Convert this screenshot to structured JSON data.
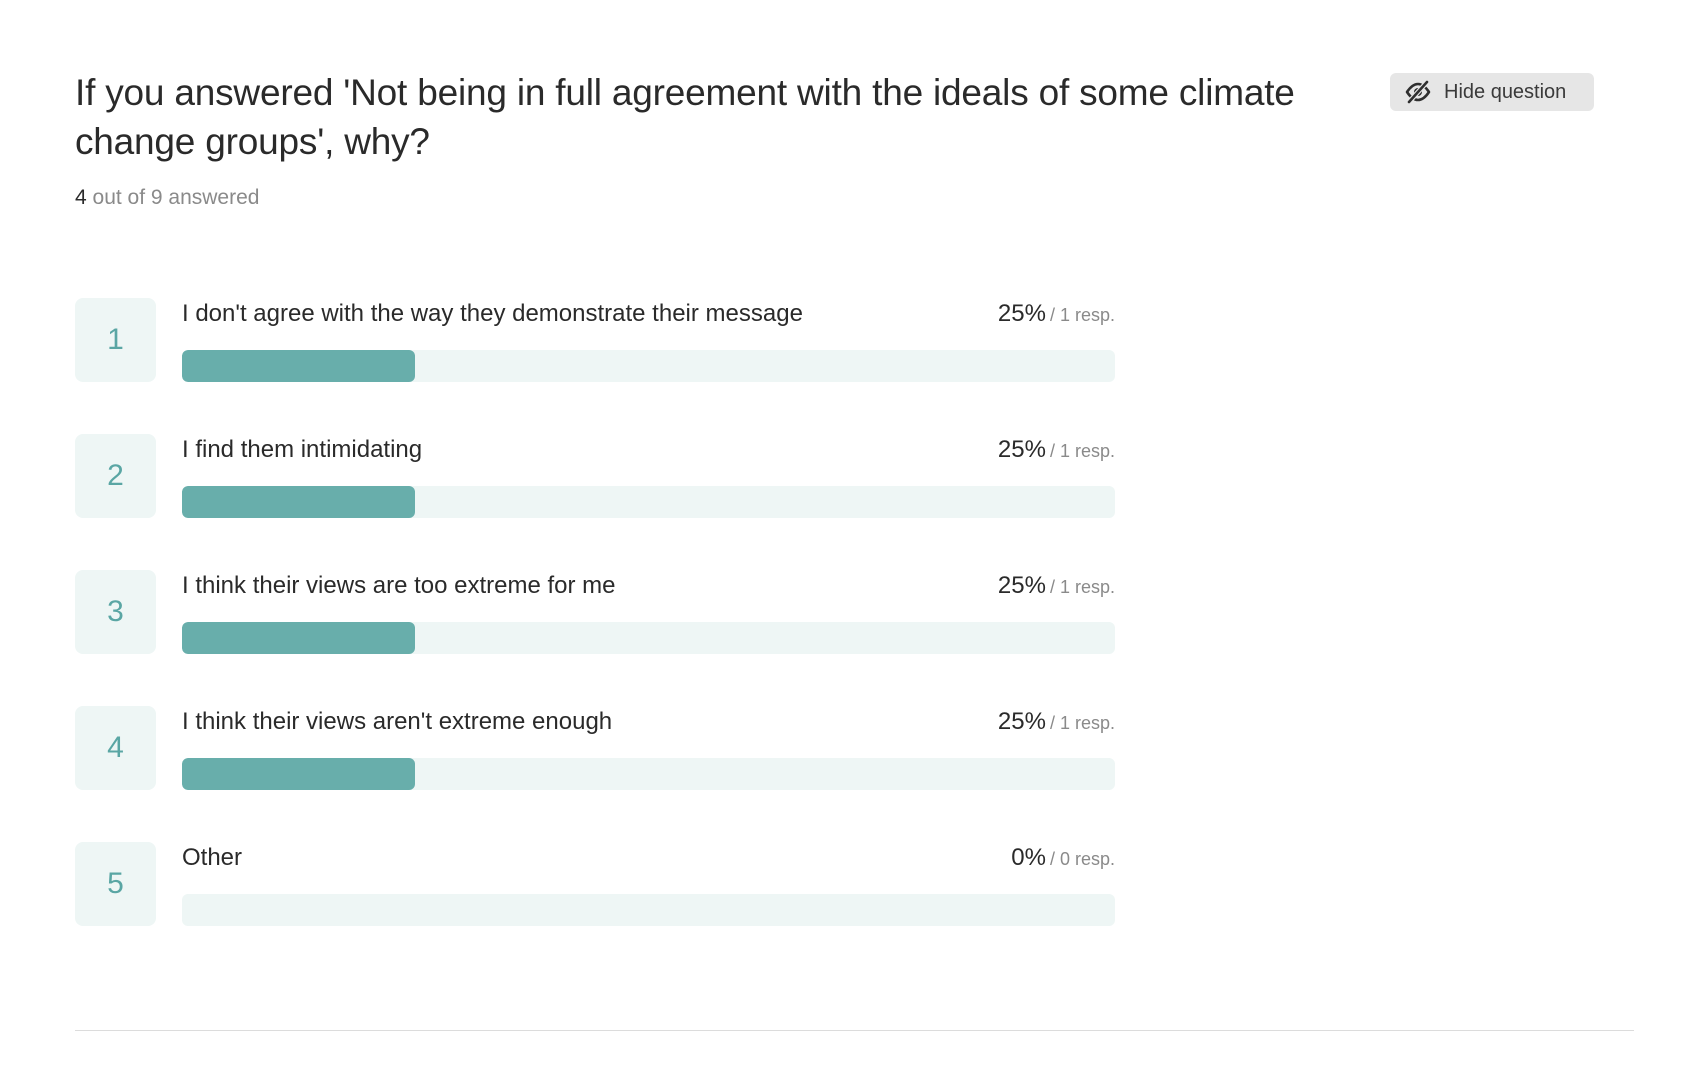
{
  "question": {
    "title": "If you answered 'Not being in full agreement with the ideals of some climate change groups', why?",
    "answered_count": "4",
    "answered_rest": " out of 9 answered"
  },
  "hide_button": {
    "label": "Hide question",
    "icon": "eye-slash-icon"
  },
  "colors": {
    "accent": "#68aeab",
    "track": "#eef6f5",
    "number": "#5aa6a4"
  },
  "options": [
    {
      "num": "1",
      "label": "I don't agree with the way they demonstrate their message",
      "pct": "25%",
      "resp": "/ 1 resp.",
      "fraction": 0.25
    },
    {
      "num": "2",
      "label": "I find them intimidating",
      "pct": "25%",
      "resp": "/ 1 resp.",
      "fraction": 0.25
    },
    {
      "num": "3",
      "label": "I think their views are too extreme for me",
      "pct": "25%",
      "resp": "/ 1 resp.",
      "fraction": 0.25
    },
    {
      "num": "4",
      "label": "I think their views aren't extreme enough",
      "pct": "25%",
      "resp": "/ 1 resp.",
      "fraction": 0.25
    },
    {
      "num": "5",
      "label": "Other",
      "pct": "0%",
      "resp": "/ 0 resp.",
      "fraction": 0
    }
  ]
}
